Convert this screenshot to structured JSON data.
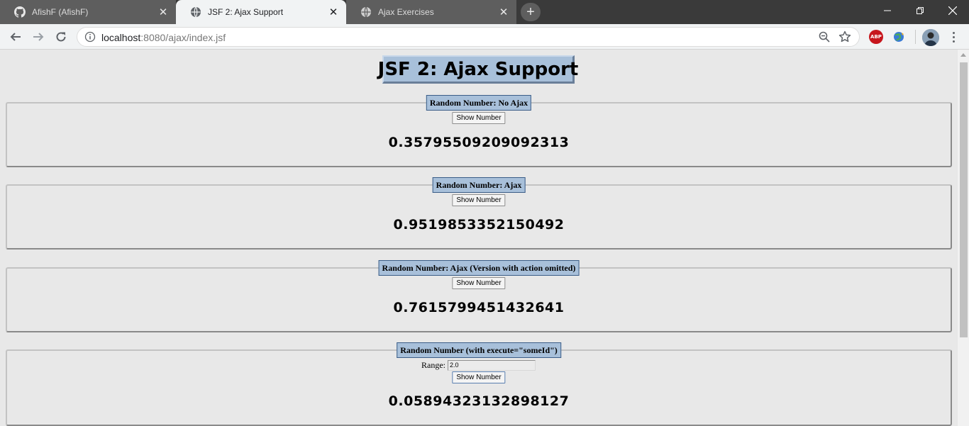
{
  "browser": {
    "tabs": [
      {
        "title": "AfishF (AfishF)",
        "icon": "github-icon",
        "active": false
      },
      {
        "title": "JSF 2: Ajax Support",
        "icon": "globe-icon",
        "active": true
      },
      {
        "title": "Ajax Exercises",
        "icon": "globe-icon",
        "active": false
      }
    ],
    "url_host": "localhost",
    "url_path": ":8080/ajax/index.jsf",
    "extensions": {
      "abp_label": "ABP"
    }
  },
  "page": {
    "title": "JSF 2: Ajax Support",
    "sections": [
      {
        "legend": "Random Number: No Ajax",
        "button": "Show Number",
        "result": "0.35795509209092313"
      },
      {
        "legend": "Random Number: Ajax",
        "button": "Show Number",
        "result": "0.9519853352150492"
      },
      {
        "legend": "Random Number: Ajax (Version with action omitted)",
        "button": "Show Number",
        "result": "0.7615799451432641"
      },
      {
        "legend": "Random Number (with execute=\"someId\")",
        "range_label": "Range:",
        "range_value": "2.0",
        "button": "Show Number",
        "result": "0.05894323132898127"
      }
    ]
  },
  "colors": {
    "header_bg": "#a8c0da",
    "legend_border": "#3b5d87",
    "page_bg": "#e8e8e8"
  }
}
